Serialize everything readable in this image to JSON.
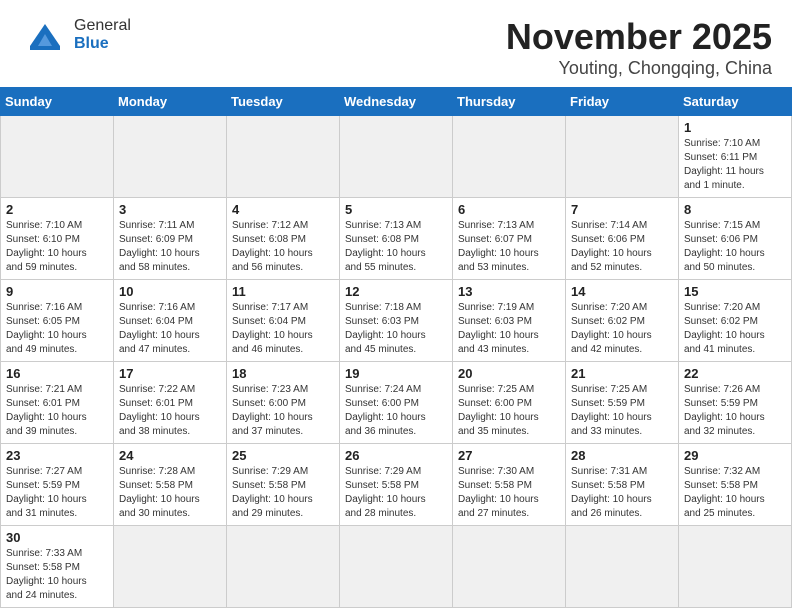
{
  "header": {
    "title": "November 2025",
    "subtitle": "Youting, Chongqing, China",
    "logo_general": "General",
    "logo_blue": "Blue"
  },
  "days_of_week": [
    "Sunday",
    "Monday",
    "Tuesday",
    "Wednesday",
    "Thursday",
    "Friday",
    "Saturday"
  ],
  "weeks": [
    {
      "cells": [
        {
          "day": null,
          "detail": null
        },
        {
          "day": null,
          "detail": null
        },
        {
          "day": null,
          "detail": null
        },
        {
          "day": null,
          "detail": null
        },
        {
          "day": null,
          "detail": null
        },
        {
          "day": null,
          "detail": null
        },
        {
          "day": "1",
          "detail": "Sunrise: 7:10 AM\nSunset: 6:11 PM\nDaylight: 11 hours\nand 1 minute."
        }
      ]
    },
    {
      "cells": [
        {
          "day": "2",
          "detail": "Sunrise: 7:10 AM\nSunset: 6:10 PM\nDaylight: 10 hours\nand 59 minutes."
        },
        {
          "day": "3",
          "detail": "Sunrise: 7:11 AM\nSunset: 6:09 PM\nDaylight: 10 hours\nand 58 minutes."
        },
        {
          "day": "4",
          "detail": "Sunrise: 7:12 AM\nSunset: 6:08 PM\nDaylight: 10 hours\nand 56 minutes."
        },
        {
          "day": "5",
          "detail": "Sunrise: 7:13 AM\nSunset: 6:08 PM\nDaylight: 10 hours\nand 55 minutes."
        },
        {
          "day": "6",
          "detail": "Sunrise: 7:13 AM\nSunset: 6:07 PM\nDaylight: 10 hours\nand 53 minutes."
        },
        {
          "day": "7",
          "detail": "Sunrise: 7:14 AM\nSunset: 6:06 PM\nDaylight: 10 hours\nand 52 minutes."
        },
        {
          "day": "8",
          "detail": "Sunrise: 7:15 AM\nSunset: 6:06 PM\nDaylight: 10 hours\nand 50 minutes."
        }
      ]
    },
    {
      "cells": [
        {
          "day": "9",
          "detail": "Sunrise: 7:16 AM\nSunset: 6:05 PM\nDaylight: 10 hours\nand 49 minutes."
        },
        {
          "day": "10",
          "detail": "Sunrise: 7:16 AM\nSunset: 6:04 PM\nDaylight: 10 hours\nand 47 minutes."
        },
        {
          "day": "11",
          "detail": "Sunrise: 7:17 AM\nSunset: 6:04 PM\nDaylight: 10 hours\nand 46 minutes."
        },
        {
          "day": "12",
          "detail": "Sunrise: 7:18 AM\nSunset: 6:03 PM\nDaylight: 10 hours\nand 45 minutes."
        },
        {
          "day": "13",
          "detail": "Sunrise: 7:19 AM\nSunset: 6:03 PM\nDaylight: 10 hours\nand 43 minutes."
        },
        {
          "day": "14",
          "detail": "Sunrise: 7:20 AM\nSunset: 6:02 PM\nDaylight: 10 hours\nand 42 minutes."
        },
        {
          "day": "15",
          "detail": "Sunrise: 7:20 AM\nSunset: 6:02 PM\nDaylight: 10 hours\nand 41 minutes."
        }
      ]
    },
    {
      "cells": [
        {
          "day": "16",
          "detail": "Sunrise: 7:21 AM\nSunset: 6:01 PM\nDaylight: 10 hours\nand 39 minutes."
        },
        {
          "day": "17",
          "detail": "Sunrise: 7:22 AM\nSunset: 6:01 PM\nDaylight: 10 hours\nand 38 minutes."
        },
        {
          "day": "18",
          "detail": "Sunrise: 7:23 AM\nSunset: 6:00 PM\nDaylight: 10 hours\nand 37 minutes."
        },
        {
          "day": "19",
          "detail": "Sunrise: 7:24 AM\nSunset: 6:00 PM\nDaylight: 10 hours\nand 36 minutes."
        },
        {
          "day": "20",
          "detail": "Sunrise: 7:25 AM\nSunset: 6:00 PM\nDaylight: 10 hours\nand 35 minutes."
        },
        {
          "day": "21",
          "detail": "Sunrise: 7:25 AM\nSunset: 5:59 PM\nDaylight: 10 hours\nand 33 minutes."
        },
        {
          "day": "22",
          "detail": "Sunrise: 7:26 AM\nSunset: 5:59 PM\nDaylight: 10 hours\nand 32 minutes."
        }
      ]
    },
    {
      "cells": [
        {
          "day": "23",
          "detail": "Sunrise: 7:27 AM\nSunset: 5:59 PM\nDaylight: 10 hours\nand 31 minutes."
        },
        {
          "day": "24",
          "detail": "Sunrise: 7:28 AM\nSunset: 5:58 PM\nDaylight: 10 hours\nand 30 minutes."
        },
        {
          "day": "25",
          "detail": "Sunrise: 7:29 AM\nSunset: 5:58 PM\nDaylight: 10 hours\nand 29 minutes."
        },
        {
          "day": "26",
          "detail": "Sunrise: 7:29 AM\nSunset: 5:58 PM\nDaylight: 10 hours\nand 28 minutes."
        },
        {
          "day": "27",
          "detail": "Sunrise: 7:30 AM\nSunset: 5:58 PM\nDaylight: 10 hours\nand 27 minutes."
        },
        {
          "day": "28",
          "detail": "Sunrise: 7:31 AM\nSunset: 5:58 PM\nDaylight: 10 hours\nand 26 minutes."
        },
        {
          "day": "29",
          "detail": "Sunrise: 7:32 AM\nSunset: 5:58 PM\nDaylight: 10 hours\nand 25 minutes."
        }
      ]
    },
    {
      "cells": [
        {
          "day": "30",
          "detail": "Sunrise: 7:33 AM\nSunset: 5:58 PM\nDaylight: 10 hours\nand 24 minutes."
        },
        {
          "day": null,
          "detail": null
        },
        {
          "day": null,
          "detail": null
        },
        {
          "day": null,
          "detail": null
        },
        {
          "day": null,
          "detail": null
        },
        {
          "day": null,
          "detail": null
        },
        {
          "day": null,
          "detail": null
        }
      ]
    }
  ]
}
